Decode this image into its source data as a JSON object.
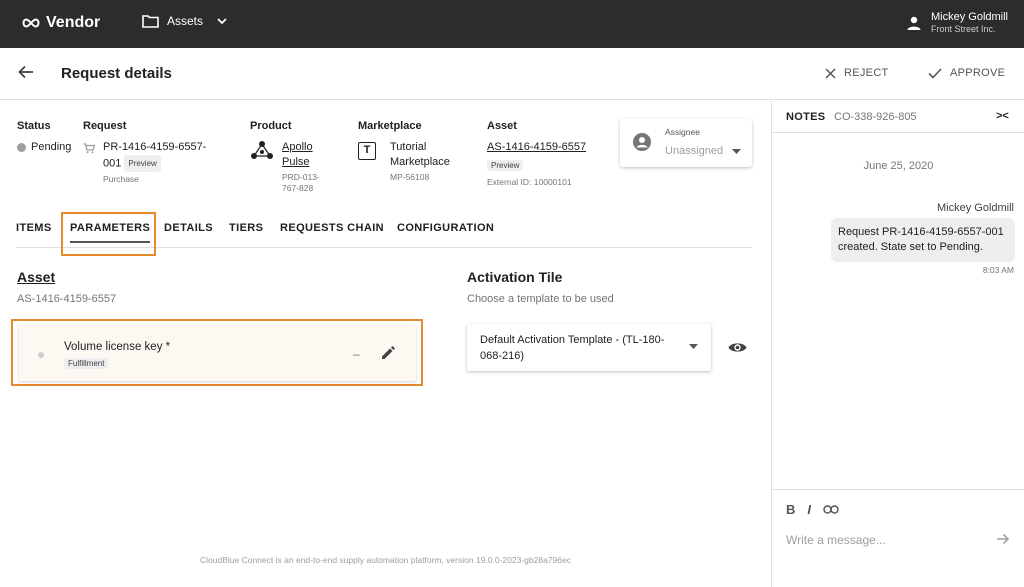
{
  "topbar": {
    "brand": "Vendor",
    "module": "Assets",
    "user_name": "Mickey Goldmill",
    "user_org": "Front Street Inc."
  },
  "header": {
    "title": "Request details",
    "reject_label": "REJECT",
    "approve_label": "APPROVE"
  },
  "info": {
    "status": {
      "label": "Status",
      "value": "Pending"
    },
    "request": {
      "label": "Request",
      "id_line1": "PR-1416-4159-6557-",
      "id_line2": "001",
      "chip": "Preview",
      "type": "Purchase"
    },
    "product": {
      "label": "Product",
      "name_line1": "Apollo",
      "name_line2": "Pulse",
      "id_line1": "PRD-013-",
      "id_line2": "767-828"
    },
    "marketplace": {
      "label": "Marketplace",
      "icon_letter": "T",
      "name_line1": "Tutorial",
      "name_line2": "Marketplace",
      "id": "MP-56108"
    },
    "asset": {
      "label": "Asset",
      "id": "AS-1416-4159-6557",
      "chip": "Preview",
      "external": "External ID: 10000101"
    },
    "assignee": {
      "label": "Assignee",
      "value": "Unassigned"
    }
  },
  "tabs": [
    "ITEMS",
    "PARAMETERS",
    "DETAILS",
    "TIERS",
    "REQUESTS CHAIN",
    "CONFIGURATION"
  ],
  "active_tab": "PARAMETERS",
  "asset_section": {
    "heading": "Asset",
    "id": "AS-1416-4159-6557",
    "parameter": {
      "name": "Volume license key *",
      "tag": "Fulfillment",
      "value": "–"
    }
  },
  "activation": {
    "heading": "Activation Tile",
    "hint": "Choose a template to be used",
    "selected_line1": "Default Activation Template - (TL-180-",
    "selected_line2": "068-216)"
  },
  "footer": "CloudBlue Connect is an end-to-end supply automation platform, version 19.0.0-2023-gb28a796ec",
  "notes": {
    "title": "NOTES",
    "id": "CO-338-926-805",
    "collapse": "><",
    "date": "June 25, 2020",
    "author": "Mickey Goldmill",
    "message": "Request PR-1416-4159-6557-001 created. State set to Pending.",
    "time": "8:03 AM",
    "placeholder": "Write a message..."
  },
  "colors": {
    "topbar": "#2c2c2c",
    "highlight": "#e68a2e",
    "bubble": "#eeeeee",
    "param_card": "#fdf8f2"
  }
}
